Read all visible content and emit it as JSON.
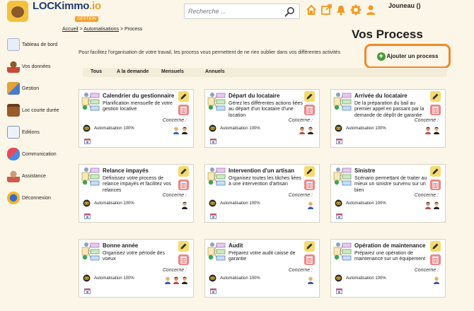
{
  "app": {
    "logo_text": "LOCKimmo",
    "logo_suffix": ".io",
    "logo_tagline": "GESTION",
    "search_placeholder": "Recherche ...",
    "user_name": "Jouneau ()",
    "top_icons": [
      "home-icon",
      "external-link-icon",
      "bell-icon",
      "gear-icon",
      "user-icon"
    ]
  },
  "sidebar": {
    "items": [
      {
        "label": "Tableau de bord",
        "icon": "dashboard-icon"
      },
      {
        "label": "Vos données",
        "icon": "person-icon"
      },
      {
        "label": "Gestion",
        "icon": "management-icon"
      },
      {
        "label": "Loc courte durée",
        "icon": "suitcase-icon"
      },
      {
        "label": "Editions",
        "icon": "document-icon"
      },
      {
        "label": "Communication",
        "icon": "chat-icon"
      },
      {
        "label": "Assistance",
        "icon": "assistant-icon"
      },
      {
        "label": "Déconnexion",
        "icon": "logout-icon"
      }
    ]
  },
  "breadcrumb": {
    "home": "Accueil",
    "sep1": ">",
    "section": "Automatisations",
    "sep2": ">",
    "current": "Process"
  },
  "page": {
    "title": "Vos Process",
    "intro": "Pour facilitez l'organisation de votre travail, les process vous permettent de ne rien oublier dans vos différentes activités",
    "add_button": "Ajouter un process"
  },
  "filters": [
    "Tous",
    "A la demande",
    "Mensuels",
    "Annuels"
  ],
  "labels": {
    "concern": "Concerne :",
    "automation": "Automatisation 100%"
  },
  "colors": {
    "background": "#fcf6e8",
    "accent_orange": "#ee8a2b",
    "edit_yellow": "#f5db6e",
    "delete_red": "#ef8585",
    "add_green": "#4a9a3a"
  },
  "cards": [
    {
      "title": "Calendrier du gestionnaire",
      "desc": "Planification mensuelle de votre gestion locative",
      "people": [
        "manager",
        "user"
      ]
    },
    {
      "title": "Départ du locataire",
      "desc": "Gérez les différentes actions liées au départ d'un locataire d'une location",
      "people": [
        "team",
        "user"
      ]
    },
    {
      "title": "Arrivée du locataire",
      "desc": "De la préparation du bail au premier appel en passant par la demande de dépôt de garantie",
      "people": [
        "team",
        "user"
      ]
    },
    {
      "title": "Relance impayés",
      "desc": "Définissez votre process de relance impayés et facilitez vos relances",
      "people": [
        "user"
      ]
    },
    {
      "title": "Intervention d'un artisan",
      "desc": "Organisez toutes les tâches liées à une intervention d'artisan",
      "people": [
        "worker"
      ]
    },
    {
      "title": "Sinistre",
      "desc": "Scénario permettant de traiter au mieux un sinistre survenu sur un bien",
      "people": [
        "team",
        "user"
      ]
    },
    {
      "title": "Bonne année",
      "desc": "Organisez votre période des voeux",
      "people": [
        "worker",
        "team",
        "user"
      ]
    },
    {
      "title": "Audit",
      "desc": "Préparez votre audit caisse de garantie",
      "people": [
        "worker"
      ]
    },
    {
      "title": "Opération de maintenance",
      "desc": "Préparez une opération de maintenance sur un équipement",
      "people": [
        "worker"
      ]
    }
  ]
}
